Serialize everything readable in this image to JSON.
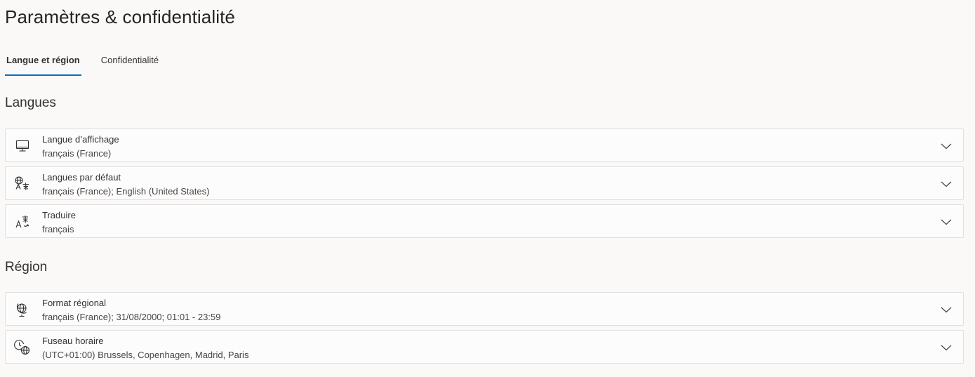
{
  "page": {
    "title": "Paramètres & confidentialité"
  },
  "tabs": [
    {
      "label": "Langue et région",
      "active": true
    },
    {
      "label": "Confidentialité",
      "active": false
    }
  ],
  "sections": {
    "languages": {
      "title": "Langues",
      "items": [
        {
          "icon": "monitor-icon",
          "label": "Langue d’affichage",
          "value": "français (France)"
        },
        {
          "icon": "globe-language-icon",
          "label": "Langues par défaut",
          "value": "français (France); English (United States)"
        },
        {
          "icon": "translate-icon",
          "label": "Traduire",
          "value": "français"
        }
      ]
    },
    "region": {
      "title": "Région",
      "items": [
        {
          "icon": "globe-stand-icon",
          "label": "Format régional",
          "value": "français (France); 31/08/2000; 01:01 - 23:59"
        },
        {
          "icon": "clock-globe-icon",
          "label": "Fuseau horaire",
          "value": "(UTC+01:00) Brussels, Copenhagen, Madrid, Paris"
        }
      ]
    }
  },
  "colors": {
    "background": "#faf9f8",
    "accent": "#0f6cbd",
    "card_border": "#e1dfdd",
    "text": "#323130"
  }
}
